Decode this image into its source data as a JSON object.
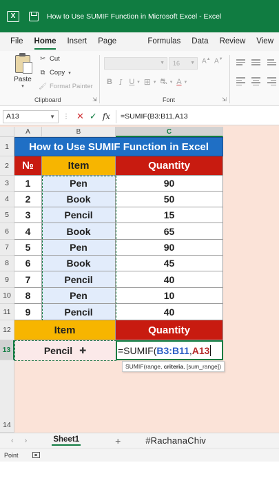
{
  "window": {
    "title": "How to Use SUMIF Function in Microsoft Excel  -  Excel",
    "app_icon": "excel-icon",
    "save_icon": "save-icon"
  },
  "menu": {
    "tabs": [
      "File",
      "Home",
      "Insert",
      "Page Layout",
      "Formulas",
      "Data",
      "Review",
      "View"
    ],
    "active": "Home"
  },
  "ribbon": {
    "clipboard": {
      "paste_label": "Paste",
      "cut_label": "Cut",
      "copy_label": "Copy",
      "format_painter_label": "Format Painter",
      "group_label": "Clipboard"
    },
    "font": {
      "font_name": "",
      "font_size": "16",
      "group_label": "Font",
      "bold": "B",
      "italic": "I",
      "underline": "U"
    }
  },
  "formula_bar": {
    "name_box": "A13",
    "formula": "=SUMIF(B3:B11,A13"
  },
  "grid": {
    "columns": [
      "A",
      "B",
      "C"
    ],
    "rows": [
      "1",
      "2",
      "3",
      "4",
      "5",
      "6",
      "7",
      "8",
      "9",
      "10",
      "11",
      "12",
      "13",
      "14"
    ],
    "title": "How to Use SUMIF Function in Excel",
    "headers": {
      "num": "№",
      "item": "Item",
      "quantity": "Quantity"
    },
    "data": [
      {
        "num": "1",
        "item": "Pen",
        "qty": "90"
      },
      {
        "num": "2",
        "item": "Book",
        "qty": "50"
      },
      {
        "num": "3",
        "item": "Pencil",
        "qty": "15"
      },
      {
        "num": "4",
        "item": "Book",
        "qty": "65"
      },
      {
        "num": "5",
        "item": "Pen",
        "qty": "90"
      },
      {
        "num": "6",
        "item": "Book",
        "qty": "45"
      },
      {
        "num": "7",
        "item": "Pencil",
        "qty": "40"
      },
      {
        "num": "8",
        "item": "Pen",
        "qty": "10"
      },
      {
        "num": "9",
        "item": "Pencil",
        "qty": "40"
      }
    ],
    "summary_headers": {
      "item": "Item",
      "quantity": "Quantity"
    },
    "criteria_value": "Pencil",
    "editing": {
      "prefix": "=SUMIF(",
      "range_ref": "B3:B11",
      "comma": ",",
      "criteria_ref": "A13"
    },
    "tooltip": {
      "start": "SUMIF(range, ",
      "bold": "criteria",
      "end": ", [sum_range])"
    }
  },
  "sheet_tabs": {
    "active": "Sheet1",
    "watermark": "#RachanaChiv"
  },
  "status": {
    "mode": "Point"
  },
  "colors": {
    "title_bg": "#1f6fc5",
    "header_red": "#c81b10",
    "header_yellow": "#f7b500",
    "item_bg": "#e2ecfb",
    "accent": "#107c41",
    "sheet_bg": "#fbe3d8"
  }
}
